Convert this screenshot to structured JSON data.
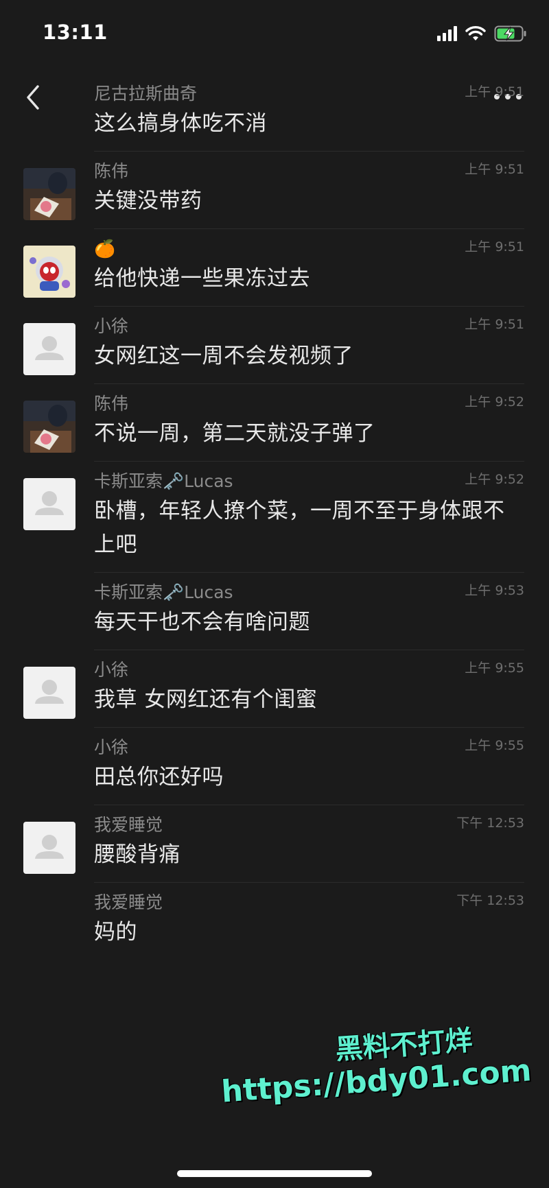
{
  "status": {
    "time": "13:11",
    "icons": [
      "cellular-signal-icon",
      "wifi-icon",
      "battery-charging-icon"
    ],
    "battery_color": "#4cd964"
  },
  "nav": {
    "back_icon": "chevron-left-icon",
    "more_icon": "ellipsis-icon"
  },
  "messages": [
    {
      "sender": "尼古拉斯曲奇",
      "time": "上午 9:51",
      "text": "这么搞身体吃不消",
      "avatar": "none"
    },
    {
      "sender": "陈伟",
      "time": "上午 9:51",
      "text": "关键没带药",
      "avatar": "photo"
    },
    {
      "sender": "🍊",
      "time": "上午 9:51",
      "text": "给他快递一些果冻过去",
      "avatar": "cartoon"
    },
    {
      "sender": "小徐",
      "time": "上午 9:51",
      "text": "女网红这一周不会发视频了",
      "avatar": "default"
    },
    {
      "sender": "陈伟",
      "time": "上午 9:52",
      "text": "不说一周，第二天就没子弹了",
      "avatar": "photo"
    },
    {
      "sender": "卡斯亚索🗝️Lucas",
      "time": "上午 9:52",
      "text": "卧槽，年轻人撩个菜，一周不至于身体跟不上吧",
      "avatar": "default"
    },
    {
      "sender": "卡斯亚索🗝️Lucas",
      "time": "上午 9:53",
      "text": "每天干也不会有啥问题",
      "avatar": "none"
    },
    {
      "sender": "小徐",
      "time": "上午 9:55",
      "text": "我草 女网红还有个闺蜜",
      "avatar": "default"
    },
    {
      "sender": "小徐",
      "time": "上午 9:55",
      "text": "田总你还好吗",
      "avatar": "none"
    },
    {
      "sender": "我爱睡觉",
      "time": "下午 12:53",
      "text": "腰酸背痛",
      "avatar": "default"
    },
    {
      "sender": "我爱睡觉",
      "time": "下午 12:53",
      "text": "妈的",
      "avatar": "none"
    }
  ],
  "watermark": {
    "line1": "黑料不打烊",
    "line2": "https://bdy01.com",
    "color": "#5ef0cf"
  }
}
